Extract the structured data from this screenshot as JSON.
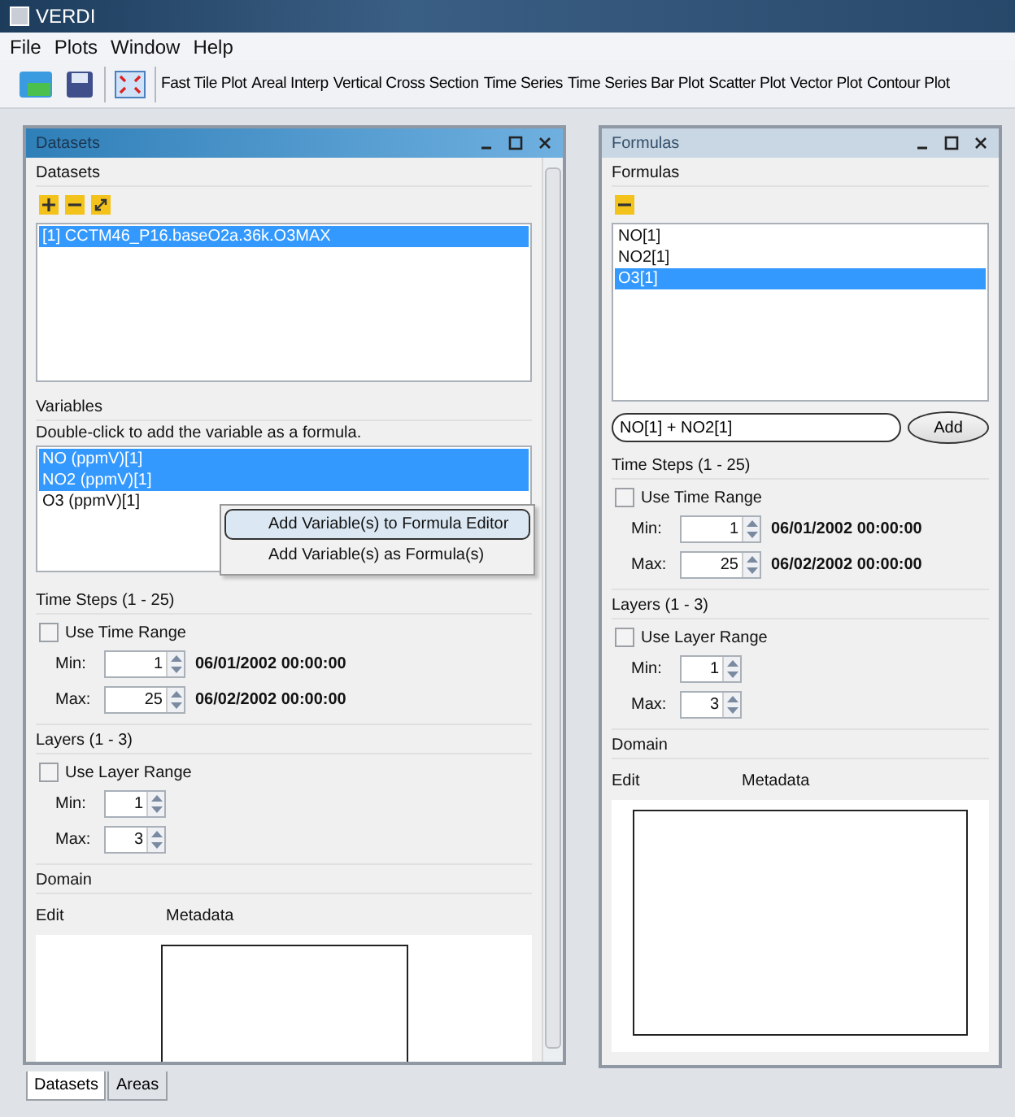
{
  "window": {
    "title": "VERDI"
  },
  "menu": [
    "File",
    "Plots",
    "Window",
    "Help"
  ],
  "toolbar": {
    "icons": [
      {
        "kind": "open"
      },
      {
        "kind": "save"
      },
      {
        "kind": "fit"
      }
    ],
    "buttons": [
      "Fast Tile Plot",
      "Areal Interp",
      "Vertical Cross Section",
      "Time Series",
      "Time Series Bar Plot",
      "Scatter Plot",
      "Vector Plot",
      "Contour Plot"
    ]
  },
  "datasets_panel": {
    "title": "Datasets",
    "active": true,
    "datasets": {
      "label": "Datasets",
      "tools": [
        {
          "kind": "add"
        },
        {
          "kind": "remove"
        },
        {
          "kind": "expand"
        }
      ],
      "items": [
        {
          "text": "[1] CCTM46_P16.baseO2a.36k.O3MAX",
          "selected": true
        }
      ]
    },
    "variables": {
      "label": "Variables",
      "hint": "Double-click to add the variable as a formula.",
      "items": [
        {
          "text": "NO (ppmV)[1]",
          "selected": true
        },
        {
          "text": "NO2 (ppmV)[1]",
          "selected": true
        },
        {
          "text": "O3 (ppmV)[1]",
          "selected": false
        }
      ]
    },
    "context_menu": [
      {
        "label": "Add Variable(s) to Formula Editor",
        "selected": true
      },
      {
        "label": "Add Variable(s) as Formula(s)",
        "selected": false
      }
    ],
    "time_steps": {
      "label": "Time Steps (1 - 25)",
      "use_range": {
        "label": "Use Time Range",
        "checked": false
      },
      "rows": [
        {
          "label": "Min:",
          "value": "1",
          "date": "06/01/2002 00:00:00"
        },
        {
          "label": "Max:",
          "value": "25",
          "date": "06/02/2002 00:00:00"
        }
      ]
    },
    "layers": {
      "label": "Layers (1 - 3)",
      "use_range": {
        "label": "Use Layer Range",
        "checked": false
      },
      "rows": [
        {
          "label": "Min:",
          "value": "1"
        },
        {
          "label": "Max:",
          "value": "3"
        }
      ]
    },
    "domain": {
      "label": "Domain",
      "edit": "Edit",
      "metadata": "Metadata"
    }
  },
  "tabs": [
    {
      "label": "Datasets",
      "selected": true
    },
    {
      "label": "Areas",
      "selected": false
    }
  ],
  "formulas_panel": {
    "title": "Formulas",
    "active": false,
    "formulas": {
      "label": "Formulas",
      "tools": [
        {
          "kind": "remove"
        }
      ],
      "items": [
        {
          "text": "NO[1]",
          "selected": false
        },
        {
          "text": "NO2[1]",
          "selected": false
        },
        {
          "text": "O3[1]",
          "selected": true
        }
      ]
    },
    "input": {
      "value": "NO[1] + NO2[1]"
    },
    "add_button": "Add",
    "time_steps": {
      "label": "Time Steps (1 - 25)",
      "use_range": {
        "label": "Use Time Range",
        "checked": false
      },
      "rows": [
        {
          "label": "Min:",
          "value": "1",
          "date": "06/01/2002 00:00:00"
        },
        {
          "label": "Max:",
          "value": "25",
          "date": "06/02/2002 00:00:00"
        }
      ]
    },
    "layers": {
      "label": "Layers (1 - 3)",
      "use_range": {
        "label": "Use Layer Range",
        "checked": false
      },
      "rows": [
        {
          "label": "Min:",
          "value": "1"
        },
        {
          "label": "Max:",
          "value": "3"
        }
      ]
    },
    "domain": {
      "label": "Domain",
      "edit": "Edit",
      "metadata": "Metadata"
    }
  }
}
